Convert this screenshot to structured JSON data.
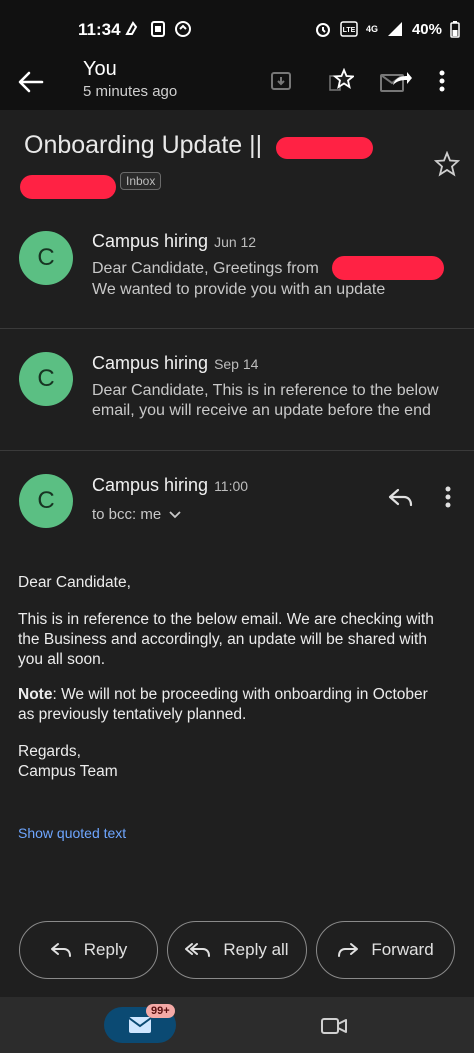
{
  "status_bar": {
    "time": "11:34",
    "network": "4G",
    "battery": "40%"
  },
  "app_bar": {
    "title": "You",
    "subtitle": "5 minutes ago"
  },
  "subject": {
    "text": "Onboarding Update || ",
    "label_badge": "Inbox"
  },
  "messages": [
    {
      "avatar": "C",
      "sender": "Campus hiring",
      "date": "Jun 12",
      "snippet_line1": "Dear Candidate, Greetings from ",
      "snippet_line2": "We wanted to provide you with an update"
    },
    {
      "avatar": "C",
      "sender": "Campus hiring",
      "date": "Sep 14",
      "snippet_line1": "Dear Candidate, This is in reference to the below",
      "snippet_line2": "email, you will receive an update before the end"
    }
  ],
  "open_message": {
    "avatar": "C",
    "sender": "Campus hiring",
    "time": "11:00",
    "recipient": "to bcc: me",
    "greeting": "Dear Candidate,",
    "para1": "This is in reference to the below email. We are checking with the Business and accordingly, an update will be shared with you all soon.",
    "note_label": "Note",
    "note_text": ": We will not be proceeding with onboarding in October as previously tentatively planned.",
    "regards": "Regards,",
    "signature": "Campus Team",
    "show_quoted": "Show quoted text"
  },
  "actions": {
    "reply": "Reply",
    "reply_all": "Reply all",
    "forward": "Forward"
  },
  "bottom_nav": {
    "mail_badge": "99+"
  },
  "colors": {
    "avatar": "#5bbf83",
    "link": "#6ea6ff",
    "redaction": "#ff2244"
  }
}
